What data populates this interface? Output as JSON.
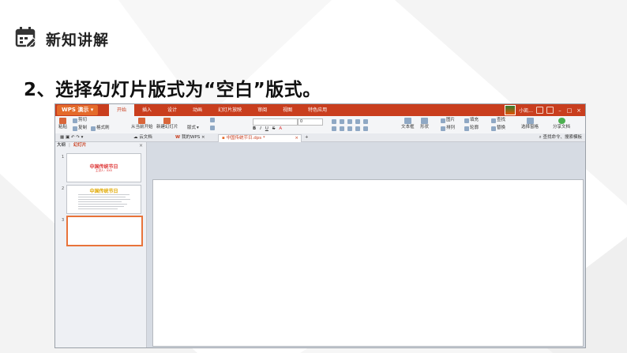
{
  "header": {
    "title": "新知讲解",
    "icon": "calendar-icon"
  },
  "instruction": "2、选择幻灯片版式为“空白”版式。",
  "app": {
    "menu_label": "WPS 演示 ▾",
    "tabs": [
      "开始",
      "插入",
      "设计",
      "动画",
      "幻灯片放映",
      "审阅",
      "视图",
      "特色应用"
    ],
    "user": "小凯...",
    "ribbon": {
      "paste": "粘贴",
      "cut": "剪切",
      "copy": "复制",
      "format_painter": "格式刷",
      "from_current": "从当前开始",
      "new_slide": "新建幻灯片",
      "layout": "版式",
      "font_size": "0",
      "textbox": "文本框",
      "shape": "形状",
      "picture": "图片",
      "arrange": "排列",
      "fill": "填充",
      "outline": "轮廓",
      "find": "查找",
      "replace": "替换",
      "select_pane": "选择窗格",
      "share_doc": "分享文档"
    },
    "doc_tabs": [
      "云文档",
      "我的WPS",
      "中国传统节日.dps *"
    ],
    "add_tab": "+",
    "search_cmd": "查找命令、搜索模板",
    "panel": {
      "tabs": [
        "大纲",
        "幻灯片"
      ],
      "slide_numbers": [
        "1",
        "2",
        "3"
      ],
      "slide1_title": "中国传统节日",
      "slide1_sub": "主讲人：XXX",
      "slide2_title": "中国传统节日"
    }
  }
}
